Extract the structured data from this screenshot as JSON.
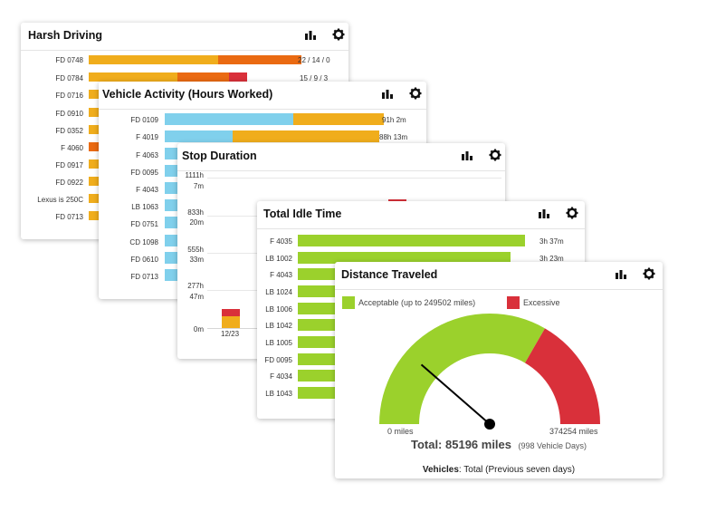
{
  "colors": {
    "yellow": "#f0ad1c",
    "orange": "#ea6a12",
    "red": "#d9303a",
    "blue": "#80d0ec",
    "green": "#9bd12c"
  },
  "icons": [
    "bar-chart-icon",
    "gear-icon"
  ],
  "harsh_driving": {
    "title": "Harsh Driving",
    "rows": [
      {
        "label": "FD 0748",
        "value": "22 / 14 / 0"
      },
      {
        "label": "FD 0784",
        "value": "15 / 9 / 3"
      },
      {
        "label": "FD 0716",
        "value": ""
      },
      {
        "label": "FD 0910",
        "value": ""
      },
      {
        "label": "FD 0352",
        "value": ""
      },
      {
        "label": "F 4060",
        "value": ""
      },
      {
        "label": "FD 0917",
        "value": ""
      },
      {
        "label": "FD 0922",
        "value": ""
      },
      {
        "label": "Lexus is 250C",
        "value": ""
      },
      {
        "label": "FD 0713",
        "value": ""
      }
    ]
  },
  "vehicle_activity": {
    "title": "Vehicle Activity (Hours Worked)",
    "rows": [
      {
        "label": "FD 0109",
        "value": "91h 2m"
      },
      {
        "label": "F 4019",
        "value": "88h 13m"
      },
      {
        "label": "F 4063",
        "value": ""
      },
      {
        "label": "FD 0095",
        "value": ""
      },
      {
        "label": "F 4043",
        "value": ""
      },
      {
        "label": "LB 1063",
        "value": ""
      },
      {
        "label": "FD 0751",
        "value": ""
      },
      {
        "label": "CD 1098",
        "value": ""
      },
      {
        "label": "FD 0610",
        "value": ""
      },
      {
        "label": "FD 0713",
        "value": ""
      }
    ]
  },
  "stop_duration": {
    "title": "Stop Duration",
    "y_ticks": [
      {
        "l1": "1111h",
        "l2": "7m"
      },
      {
        "l1": "833h",
        "l2": "20m"
      },
      {
        "l1": "555h",
        "l2": "33m"
      },
      {
        "l1": "277h",
        "l2": "47m"
      },
      {
        "l1": "0m",
        "l2": ""
      }
    ],
    "x_label": "12/23"
  },
  "total_idle_time": {
    "title": "Total Idle Time",
    "rows": [
      {
        "label": "F 4035",
        "value": "3h 37m"
      },
      {
        "label": "LB 1002",
        "value": "3h 23m"
      },
      {
        "label": "F 4043",
        "value": ""
      },
      {
        "label": "LB 1024",
        "value": ""
      },
      {
        "label": "LB 1006",
        "value": ""
      },
      {
        "label": "LB 1042",
        "value": ""
      },
      {
        "label": "LB 1005",
        "value": ""
      },
      {
        "label": "FD 0095",
        "value": ""
      },
      {
        "label": "F 4034",
        "value": ""
      },
      {
        "label": "LB 1043",
        "value": ""
      }
    ]
  },
  "distance_traveled": {
    "title": "Distance Traveled",
    "legend": {
      "acceptable": "Acceptable (up to 249502 miles)",
      "excessive": "Excessive"
    },
    "gauge": {
      "min_label": "0 miles",
      "max_label": "374254 miles",
      "min": 0,
      "max": 374254,
      "threshold": 249502,
      "value": 85196
    },
    "total_label": "Total: 85196 miles",
    "total_sub": "(998 Vehicle Days)",
    "footer_bold": "Vehicles",
    "footer_rest": ": Total (Previous seven days)"
  }
}
